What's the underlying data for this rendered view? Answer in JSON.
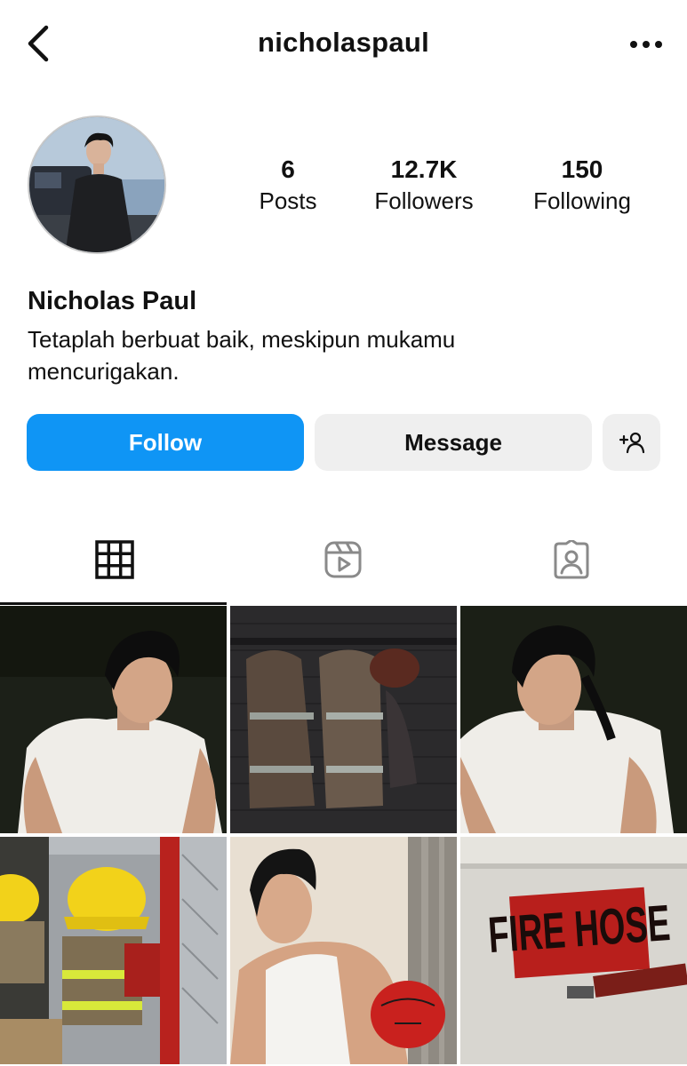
{
  "header": {
    "username": "nicholaspaul",
    "back_icon": "chevron-left-icon",
    "more_icon": "more-horizontal-icon"
  },
  "profile": {
    "avatar_icon": "profile-photo",
    "display_name": "Nicholas Paul",
    "bio_line1": "Tetaplah berbuat baik, meskipun mukamu",
    "bio_line2": "mencurigakan."
  },
  "stats": [
    {
      "value": "6",
      "label": "Posts"
    },
    {
      "value": "12.7K",
      "label": "Followers"
    },
    {
      "value": "150",
      "label": "Following"
    }
  ],
  "actions": {
    "follow_label": "Follow",
    "message_label": "Message",
    "add_icon": "add-person-icon"
  },
  "tabs": [
    {
      "icon": "grid-icon",
      "active": true
    },
    {
      "icon": "reels-icon",
      "active": false
    },
    {
      "icon": "tagged-icon",
      "active": false
    }
  ],
  "grid_posts": [
    {
      "type": "photo"
    },
    {
      "type": "photo"
    },
    {
      "type": "photo"
    },
    {
      "type": "photo"
    },
    {
      "type": "photo"
    },
    {
      "type": "photo",
      "sign_text": "FIRE HOSE"
    }
  ],
  "colors": {
    "accent": "#0f95f5",
    "button_secondary": "#efefef",
    "text": "#111111"
  }
}
